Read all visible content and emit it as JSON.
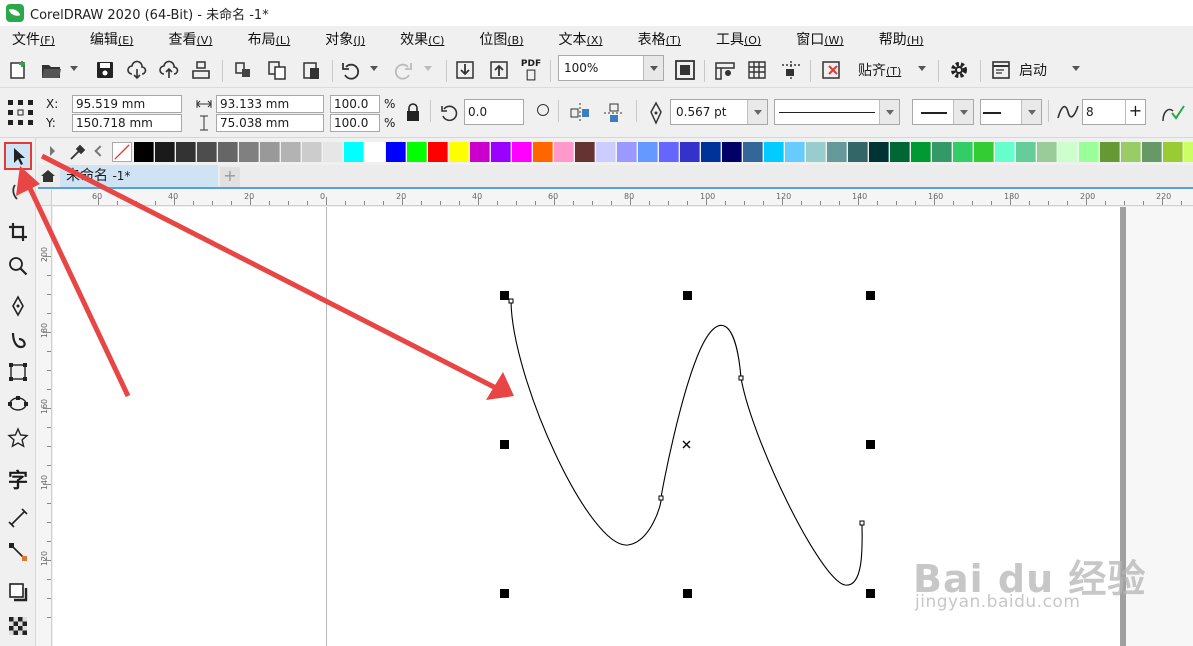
{
  "titlebar": {
    "title": "CorelDRAW 2020 (64-Bit) - 未命名 -1*"
  },
  "menu": [
    {
      "label": "文件",
      "accel": "(F)"
    },
    {
      "label": "编辑",
      "accel": "(E)"
    },
    {
      "label": "查看",
      "accel": "(V)"
    },
    {
      "label": "布局",
      "accel": "(L)"
    },
    {
      "label": "对象",
      "accel": "(J)"
    },
    {
      "label": "效果",
      "accel": "(C)"
    },
    {
      "label": "位图",
      "accel": "(B)"
    },
    {
      "label": "文本",
      "accel": "(X)"
    },
    {
      "label": "表格",
      "accel": "(T)"
    },
    {
      "label": "工具",
      "accel": "(O)"
    },
    {
      "label": "窗口",
      "accel": "(W)"
    },
    {
      "label": "帮助",
      "accel": "(H)"
    }
  ],
  "toolbar": {
    "zoom": "100%",
    "snap_label": "贴齐",
    "snap_accel": "(T)",
    "startup_label": "启动",
    "pdf_label": "PDF"
  },
  "propbar": {
    "x_label": "X:",
    "y_label": "Y:",
    "x_value": "95.519 mm",
    "y_value": "150.718 mm",
    "width_value": "93.133 mm",
    "height_value": "75.038 mm",
    "scale_x": "100.0",
    "scale_y": "100.0",
    "percent": "%",
    "rotation": "0.0",
    "outline_width": "0.567 pt",
    "smoothing": "8"
  },
  "palette": [
    "#000000",
    "#1a1a1a",
    "#333333",
    "#4d4d4d",
    "#666666",
    "#808080",
    "#999999",
    "#b3b3b3",
    "#cccccc",
    "#e6e6e6",
    "#00ffff",
    "#ffffff",
    "#0000ff",
    "#00ff00",
    "#ff0000",
    "#ffff00",
    "#cc00cc",
    "#9900ff",
    "#ff00ff",
    "#ff6600",
    "#ff99cc",
    "#663333",
    "#ccccff",
    "#9999ff",
    "#6699ff",
    "#6666ff",
    "#3333cc",
    "#003399",
    "#000066",
    "#336699",
    "#00ccff",
    "#66ccff",
    "#99cccc",
    "#669999",
    "#336666",
    "#003333",
    "#006633",
    "#009933",
    "#339966",
    "#33cc66",
    "#33cc33",
    "#66ffcc",
    "#66cc99",
    "#99cc99",
    "#ccffcc",
    "#99ff99",
    "#669933",
    "#99cc66",
    "#669966",
    "#99cc33",
    "#ccff66",
    "#66cc33"
  ],
  "tab": {
    "name": "未命名",
    "suffix": "-1*",
    "add": "+"
  },
  "hruler_ticks": [
    "60",
    "40",
    "20",
    "0",
    "20",
    "40",
    "60",
    "80",
    "100",
    "120",
    "140",
    "160",
    "180",
    "200",
    "220"
  ],
  "vruler_ticks": [
    "200",
    "180",
    "160",
    "140",
    "120"
  ],
  "watermark": {
    "logo": "Bai du 经验",
    "url": "jingyan.baidu.com"
  },
  "colors": {
    "highlight": "#e53935",
    "tab_accent": "#5aa0d8",
    "arrow": "#e84545"
  }
}
